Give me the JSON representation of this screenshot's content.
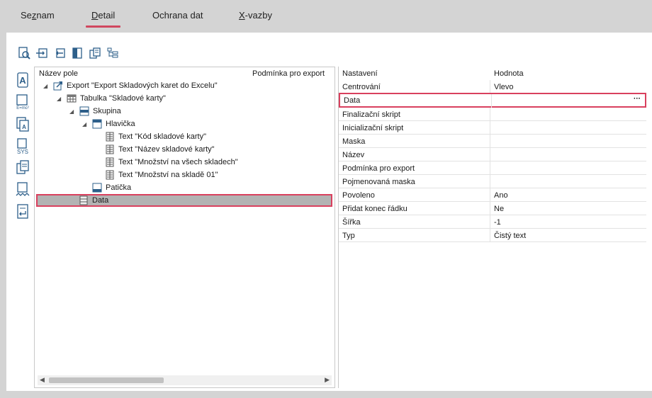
{
  "tabs": [
    {
      "label": "Seznam",
      "pre": "Se",
      "ul": "z",
      "post": "nam",
      "active": false
    },
    {
      "label": "Detail",
      "pre": "",
      "ul": "D",
      "post": "etail",
      "active": true
    },
    {
      "label": "Ochrana dat",
      "pre": "Ochrana dat",
      "ul": "",
      "post": "",
      "active": false
    },
    {
      "label": "X-vazby",
      "pre": "",
      "ul": "X",
      "post": "-vazby",
      "active": false
    }
  ],
  "colors": {
    "accent": "#d0475f",
    "highlight_border": "#d9405e",
    "selected_row": "#b3b3b3"
  },
  "tree": {
    "col_name": "Název pole",
    "col_condition": "Podmínka pro export",
    "nodes": [
      {
        "label": "Export \"Export Skladových karet do Excelu\"",
        "icon": "export-icon"
      },
      {
        "label": "Tabulka \"Skladové karty\"",
        "icon": "table-icon"
      },
      {
        "label": "Skupina",
        "icon": "group-icon"
      },
      {
        "label": "Hlavička",
        "icon": "header-icon"
      },
      {
        "label": "Text \"Kód skladové karty\"",
        "icon": "text-field-icon"
      },
      {
        "label": "Text \"Název skladové karty\"",
        "icon": "text-field-icon"
      },
      {
        "label": "Text \"Množství na všech skladech\"",
        "icon": "text-field-icon"
      },
      {
        "label": "Text \"Množství na skladě 01\"",
        "icon": "text-field-icon"
      },
      {
        "label": "Patička",
        "icon": "footer-icon"
      },
      {
        "label": "Data",
        "icon": "data-icon"
      }
    ]
  },
  "props": {
    "col_setting": "Nastavení",
    "col_value": "Hodnota",
    "rows": [
      {
        "name": "Centrování",
        "value": "Vlevo"
      },
      {
        "name": "Data",
        "value": ""
      },
      {
        "name": "Finalizační skript",
        "value": ""
      },
      {
        "name": "Inicializační skript",
        "value": ""
      },
      {
        "name": "Maska",
        "value": ""
      },
      {
        "name": "Název",
        "value": ""
      },
      {
        "name": "Podmínka pro export",
        "value": ""
      },
      {
        "name": "Pojmenovaná maska",
        "value": ""
      },
      {
        "name": "Povoleno",
        "value": "Ano"
      },
      {
        "name": "Přidat konec řádku",
        "value": "Ne"
      },
      {
        "name": "Šířka",
        "value": "-1"
      },
      {
        "name": "Typ",
        "value": "Čistý text"
      }
    ],
    "ellipsis": "···"
  }
}
